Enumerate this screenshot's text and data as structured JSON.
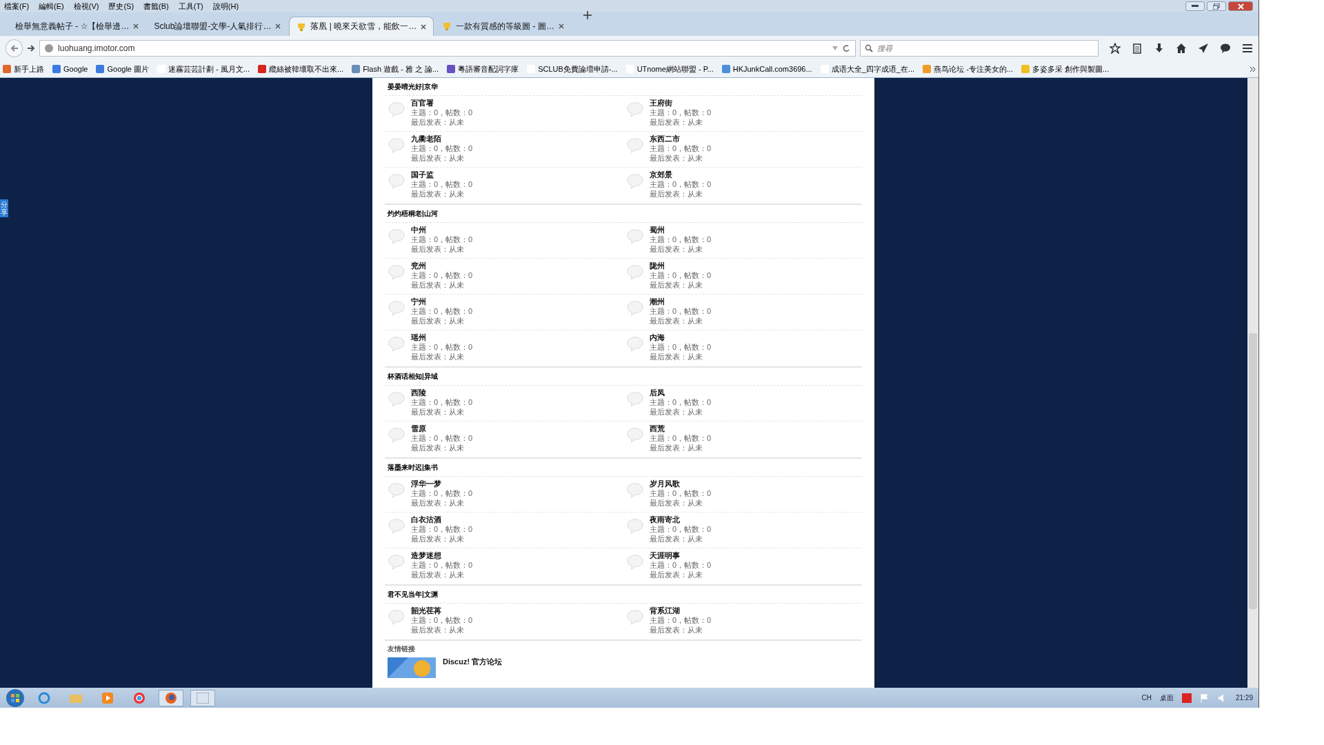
{
  "menu": [
    "檔案(F)",
    "編輯(E)",
    "檢視(V)",
    "歷史(S)",
    "書籤(B)",
    "工具(T)",
    "說明(H)"
  ],
  "tabs": [
    {
      "title": "檢舉無意義帖子 - ☆【檢舉邊…",
      "selected": false
    },
    {
      "title": "Sclub論壇聯盟-文學-人氣排行…",
      "selected": false
    },
    {
      "title": "落凰 | 曉來天欲雪，能飲一…",
      "selected": true
    },
    {
      "title": "一款有質感的等級圖 - 圖…",
      "selected": false
    }
  ],
  "address": {
    "url": "luohuang.imotor.com"
  },
  "search": {
    "placeholder": "搜尋"
  },
  "bookmarks": [
    {
      "label": "新手上路"
    },
    {
      "label": "Google"
    },
    {
      "label": "Google 圖片"
    },
    {
      "label": "迷霧芸芸計劃 - 風月文..."
    },
    {
      "label": "纜絲被韓壞取不出來..."
    },
    {
      "label": "Flash 遊戲 - 雅 之 論..."
    },
    {
      "label": "粵語審音配詞字庫"
    },
    {
      "label": "SCLUB免費論壇申請-..."
    },
    {
      "label": "UTnome網站聯盟 - P..."
    },
    {
      "label": "HKJunkCall.com3696..."
    },
    {
      "label": "成语大全_四字成语_在..."
    },
    {
      "label": "燕鸟论坛 -专注美女的..."
    },
    {
      "label": "多姿多采 創作與製圖..."
    }
  ],
  "side_tab": {
    "label": "分享"
  },
  "sections": [
    {
      "title": "晏晏晴光好|京华",
      "forums": [
        {
          "name": "百官署",
          "stats": "主题：0，帖数：0",
          "last_post": "最后发表：从未"
        },
        {
          "name": "王府街",
          "stats": "主题：0，帖数：0",
          "last_post": "最后发表：从未"
        },
        {
          "name": "九衢老陌",
          "stats": "主题：0，帖数：0",
          "last_post": "最后发表：从未"
        },
        {
          "name": "东西二市",
          "stats": "主题：0，帖数：0",
          "last_post": "最后发表：从未"
        },
        {
          "name": "国子监",
          "stats": "主题：0，帖数：0",
          "last_post": "最后发表：从未"
        },
        {
          "name": "京郊景",
          "stats": "主题：0，帖数：0",
          "last_post": "最后发表：从未"
        }
      ]
    },
    {
      "title": "灼灼梧桐老|山河",
      "forums": [
        {
          "name": "中州",
          "stats": "主题：0，帖数：0",
          "last_post": "最后发表：从未"
        },
        {
          "name": "蜀州",
          "stats": "主题：0，帖数：0",
          "last_post": "最后发表：从未"
        },
        {
          "name": "兖州",
          "stats": "主题：0，帖数：0",
          "last_post": "最后发表：从未"
        },
        {
          "name": "陇州",
          "stats": "主题：0，帖数：0",
          "last_post": "最后发表：从未"
        },
        {
          "name": "宁州",
          "stats": "主题：0，帖数：0",
          "last_post": "最后发表：从未"
        },
        {
          "name": "潮州",
          "stats": "主题：0，帖数：0",
          "last_post": "最后发表：从未"
        },
        {
          "name": "瑶州",
          "stats": "主题：0，帖数：0",
          "last_post": "最后发表：从未"
        },
        {
          "name": "内海",
          "stats": "主题：0，帖数：0",
          "last_post": "最后发表：从未"
        }
      ]
    },
    {
      "title": "杯酒话相知|异域",
      "forums": [
        {
          "name": "西陵",
          "stats": "主题：0，帖数：0",
          "last_post": "最后发表：从未"
        },
        {
          "name": "后凤",
          "stats": "主题：0，帖数：0",
          "last_post": "最后发表：从未"
        },
        {
          "name": "雪原",
          "stats": "主题：0，帖数：0",
          "last_post": "最后发表：从未"
        },
        {
          "name": "西荒",
          "stats": "主题：0，帖数：0",
          "last_post": "最后发表：从未"
        }
      ]
    },
    {
      "title": "落墨来时迟|集书",
      "forums": [
        {
          "name": "浮华一梦",
          "stats": "主题：0，帖数：0",
          "last_post": "最后发表：从未"
        },
        {
          "name": "岁月风歌",
          "stats": "主题：0，帖数：0",
          "last_post": "最后发表：从未"
        },
        {
          "name": "白衣沽酒",
          "stats": "主题：0，帖数：0",
          "last_post": "最后发表：从未"
        },
        {
          "name": "夜雨寄北",
          "stats": "主题：0，帖数：0",
          "last_post": "最后发表：从未"
        },
        {
          "name": "造梦迷想",
          "stats": "主题：0，帖数：0",
          "last_post": "最后发表：从未"
        },
        {
          "name": "天涯明事",
          "stats": "主题：0，帖数：0",
          "last_post": "最后发表：从未"
        }
      ]
    },
    {
      "title": "君不见当年|文渊",
      "forums": [
        {
          "name": "韶光荏苒",
          "stats": "主题：0，帖数：0",
          "last_post": "最后发表：从未"
        },
        {
          "name": "背系江湖",
          "stats": "主题：0，帖数：0",
          "last_post": "最后发表：从未"
        }
      ]
    }
  ],
  "links": {
    "title": "友情链接",
    "items": [
      {
        "name": "Discuz! 官方论坛"
      }
    ]
  },
  "taskbar": {
    "language": "CH",
    "desktop": "桌面",
    "clock": "21:29"
  }
}
